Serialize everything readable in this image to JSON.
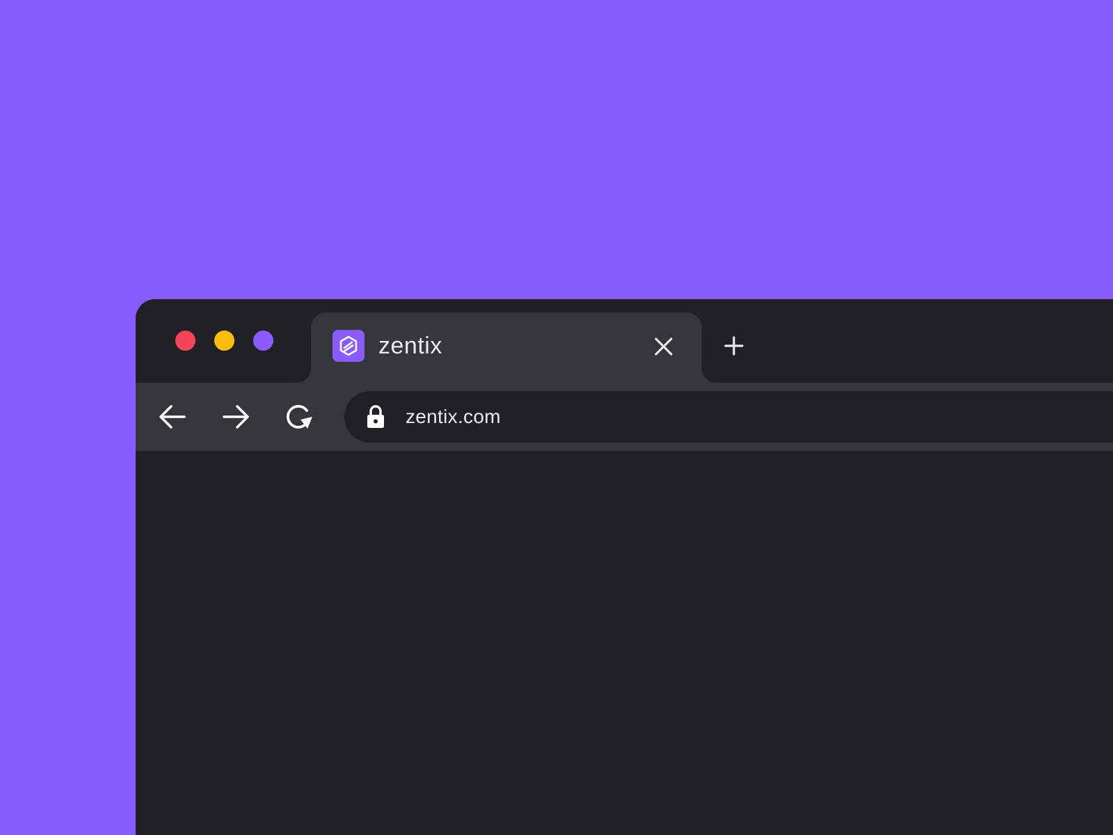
{
  "colors": {
    "background": "#875BFF",
    "window": "#202124",
    "tab_active": "#35363A",
    "text": "#E8EAED",
    "light_red": "#F5445B",
    "light_yellow": "#FDBE0A",
    "light_purple": "#8A5CFF",
    "favicon": "#8A5CFF"
  },
  "window_controls": {
    "close": "red-dot",
    "minimize": "yellow-dot",
    "maximize": "purple-dot"
  },
  "tab": {
    "title": "zentix",
    "favicon": "zentix-logo-icon",
    "close_icon": "close-icon"
  },
  "new_tab": {
    "icon": "plus-icon"
  },
  "toolbar": {
    "back_icon": "arrow-left-icon",
    "forward_icon": "arrow-right-icon",
    "reload_icon": "reload-icon"
  },
  "address_bar": {
    "url": "zentix.com",
    "security_icon": "lock-icon"
  }
}
